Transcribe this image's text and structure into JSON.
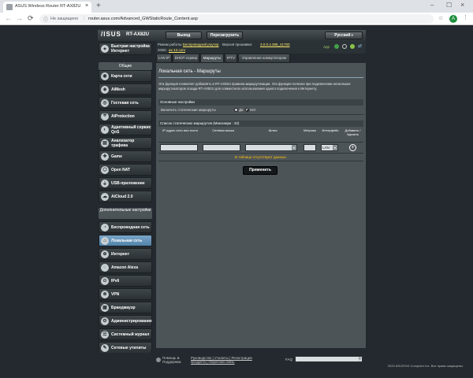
{
  "browser": {
    "tab_title": "ASUS Wireless Router RT-AX82U",
    "security_label": "Не защищено",
    "url": "router.asus.com/Advanced_GWStaticRoute_Content.asp"
  },
  "topbar": {
    "logo": "/ISUS",
    "model": "RT-AX82U",
    "logout_label": "Выход",
    "reboot_label": "Перезагрузить",
    "language": "Русский"
  },
  "info": {
    "mode_label": "Режим работы:",
    "mode_value": "Беспроводной роутер",
    "firmware_label": "Версия прошивки:",
    "firmware_value": "3.0.0.4.386_41700",
    "ssid_label": "SSID:",
    "ssid_value": "ax-12.com",
    "app_label": "App"
  },
  "sidebar": {
    "quick_setup": "Быстрая настройка Интернет",
    "general_header": "Общие",
    "general_items": [
      "Карта сети",
      "AiMesh",
      "Гостевая сеть",
      "AiProtection",
      "Адаптивный сервис QoS",
      "Анализатор трафика",
      "Game",
      "Open NAT",
      "USB-приложение",
      "AiCloud 2.0"
    ],
    "advanced_header": "Дополнительные настройки",
    "advanced_items": [
      "Беспроводная сеть",
      "Локальная сеть",
      "Интернет",
      "Amazon Alexa",
      "IPv6",
      "VPN",
      "Брандмауэр",
      "Администрирование",
      "Системный журнал",
      "Сетевые утилиты"
    ]
  },
  "tabs": [
    "LAN IP",
    "DHCP-сервер",
    "Маршруты",
    "IPTV",
    "Управление коммутатором"
  ],
  "content": {
    "title": "Локальная сеть - Маршруты",
    "description": "Эта функция позволяет добавлять в RT-AX82U правила маршрутизации. Эта функция полезна при подключении нескольких маршрутизаторов позади RT-AX82U для совместного использования одного подключения к Интернету.",
    "basic_header": "Основные настройки",
    "enable_label": "Включить статические маршруты",
    "yes_label": "Да",
    "no_label": "Нет",
    "list_header": "Список статических маршрутов (Максимум : 32)",
    "columns": [
      "IP-адрес сети или хоста",
      "Сетевая маска",
      "Шлюз",
      "Метрика",
      "Интерфейс",
      "Добавить / Удалить"
    ],
    "interface_value": "LAN",
    "empty_text": "В таблице отсутствуют данные.",
    "apply_label": "Применить"
  },
  "footer": {
    "help_label": "Помощь & Поддержка",
    "links": "Руководство | Утилиты | Регистрация продукта | Обратная связь",
    "faq_label": "FAQ",
    "copyright": "2020 ASUSTeK Computer Inc. Все права защищены."
  }
}
